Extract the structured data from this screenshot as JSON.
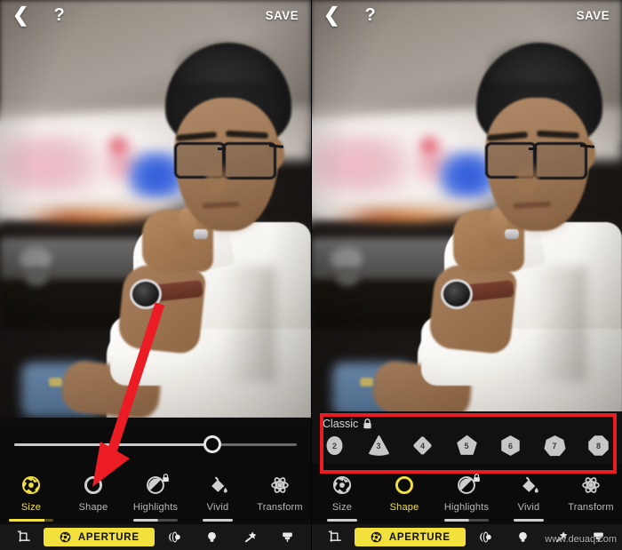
{
  "header": {
    "back_icon": "chevron-left-icon",
    "help_label": "?",
    "save_label": "SAVE"
  },
  "left_panel": {
    "slider": {
      "value_percent": 70
    },
    "tools": [
      {
        "label": "Size",
        "icon": "aperture-icon",
        "selected": true,
        "underline": "yellow"
      },
      {
        "label": "Shape",
        "icon": "circle-icon",
        "selected": false,
        "underline": "none"
      },
      {
        "label": "Highlights",
        "icon": "highlights-disc-icon",
        "selected": false,
        "underline": "greyhalf",
        "locked": true
      },
      {
        "label": "Vivid",
        "icon": "paint-bucket-icon",
        "selected": false,
        "underline": "grey"
      },
      {
        "label": "Transform",
        "icon": "transform-atom-icon",
        "selected": false,
        "underline": "none"
      }
    ],
    "tabs": [
      {
        "label": "",
        "icon": "crop-icon",
        "active": false
      },
      {
        "label": "APERTURE",
        "icon": "aperture-icon",
        "active": true
      },
      {
        "label": "",
        "icon": "lens-blur-icon",
        "active": false
      },
      {
        "label": "",
        "icon": "lightbulb-icon",
        "active": false
      },
      {
        "label": "",
        "icon": "magic-wand-icon",
        "active": false
      },
      {
        "label": "",
        "icon": "brush-icon",
        "active": false
      }
    ],
    "annotation": {
      "arrow": "red-down-arrow",
      "points_to": "Shape"
    }
  },
  "right_panel": {
    "shape_picker": {
      "title": "Classic",
      "lock_icon": "lock-icon",
      "shapes": [
        {
          "number": "2",
          "name": "oval"
        },
        {
          "number": "3",
          "name": "triangle"
        },
        {
          "number": "4",
          "name": "diamond"
        },
        {
          "number": "5",
          "name": "pentagon"
        },
        {
          "number": "6",
          "name": "hexagon"
        },
        {
          "number": "7",
          "name": "heptagon"
        },
        {
          "number": "8",
          "name": "octagon"
        }
      ],
      "highlighted": true
    },
    "tools": [
      {
        "label": "Size",
        "icon": "aperture-icon",
        "selected": false,
        "underline": "grey"
      },
      {
        "label": "Shape",
        "icon": "circle-icon",
        "selected": true,
        "underline": "none"
      },
      {
        "label": "Highlights",
        "icon": "highlights-disc-icon",
        "selected": false,
        "underline": "greyhalf",
        "locked": true
      },
      {
        "label": "Vivid",
        "icon": "paint-bucket-icon",
        "selected": false,
        "underline": "grey"
      },
      {
        "label": "Transform",
        "icon": "transform-atom-icon",
        "selected": false,
        "underline": "none"
      }
    ],
    "tabs": [
      {
        "label": "",
        "icon": "crop-icon",
        "active": false
      },
      {
        "label": "APERTURE",
        "icon": "aperture-icon",
        "active": true
      },
      {
        "label": "",
        "icon": "lens-blur-icon",
        "active": false
      },
      {
        "label": "",
        "icon": "lightbulb-icon",
        "active": false
      },
      {
        "label": "",
        "icon": "magic-wand-icon",
        "active": false
      },
      {
        "label": "",
        "icon": "brush-icon",
        "active": false
      }
    ],
    "watermark": "www.deuaq.com"
  },
  "colors": {
    "accent_yellow": "#f2e03c",
    "annotation_red": "#ec1c24",
    "panel_bg": "#0b0b0b",
    "tab_bg": "#171717"
  }
}
